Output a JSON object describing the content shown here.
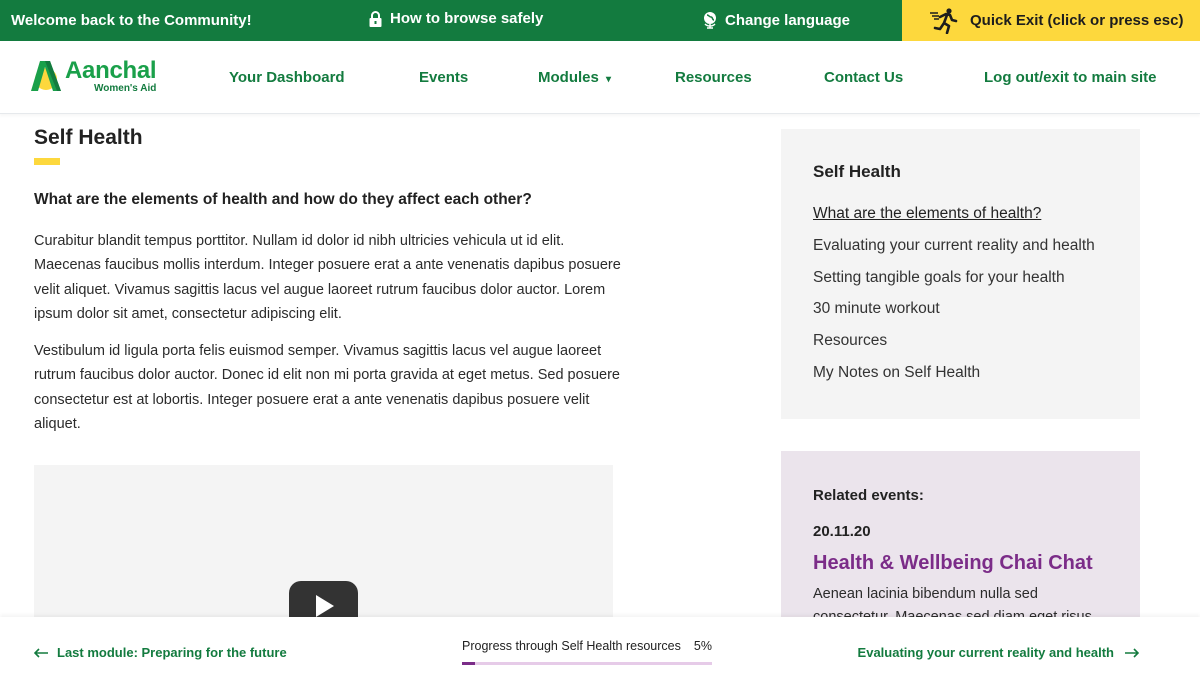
{
  "topbar": {
    "welcome": "Welcome back to the Community!",
    "browse_safely": "How to browse safely",
    "change_language": "Change language",
    "quick_exit": "Quick Exit (click or press esc)",
    "icons": {
      "browse_safely": "lock-icon",
      "change_language": "globe-icon",
      "quick_exit": "running-person-icon"
    }
  },
  "logo": {
    "name": "Aanchal",
    "tagline": "Women's Aid"
  },
  "nav": {
    "items": [
      {
        "label": "Your Dashboard"
      },
      {
        "label": "Events"
      },
      {
        "label": "Modules",
        "has_dropdown": true,
        "dropdown_glyph": "▾"
      },
      {
        "label": "Resources"
      },
      {
        "label": "Contact Us"
      },
      {
        "label": "Log out/exit to main site"
      }
    ]
  },
  "main": {
    "title": "Self Health",
    "subtitle": "What are the elements of health and how do they affect each other?",
    "paragraphs": [
      "Curabitur blandit tempus porttitor. Nullam id dolor id nibh ultricies vehicula ut id elit. Maecenas faucibus mollis interdum. Integer posuere erat a ante venenatis dapibus posuere velit aliquet. Vivamus sagittis lacus vel augue laoreet rutrum faucibus dolor auctor. Lorem ipsum dolor sit amet, consectetur adipiscing elit.",
      "Vestibulum id ligula porta felis euismod semper. Vivamus sagittis lacus vel augue laoreet rutrum faucibus dolor auctor. Donec id elit non mi porta gravida at eget metus. Sed posuere consectetur est at lobortis. Integer posuere erat a ante venenatis dapibus posuere velit aliquet."
    ],
    "video": {
      "play_icon": "play-icon"
    }
  },
  "sidebar": {
    "title": "Self Health",
    "items": [
      {
        "label": "What are the elements of health?",
        "active": true
      },
      {
        "label": "Evaluating your current reality and health"
      },
      {
        "label": "Setting tangible goals for your health"
      },
      {
        "label": "30 minute workout"
      },
      {
        "label": "Resources"
      },
      {
        "label": "My Notes on Self Health"
      }
    ]
  },
  "events": {
    "label": "Related events:",
    "date": "20.11.20",
    "name": "Health & Wellbeing Chai Chat",
    "description": "Aenean lacinia bibendum nulla sed consectetur. Maecenas sed diam eget risus"
  },
  "footer": {
    "prev_label": "Last module: Preparing for the future",
    "next_label": "Evaluating your current reality and health",
    "progress_label": "Progress through Self Health resources",
    "progress_text": "5%",
    "progress_percent": 5
  },
  "colors": {
    "brand_green": "#137b3f",
    "accent_yellow": "#fdd83d",
    "accent_purple": "#7b2c88",
    "panel_grey": "#f4f4f4",
    "events_bg": "#ebe4ec"
  }
}
